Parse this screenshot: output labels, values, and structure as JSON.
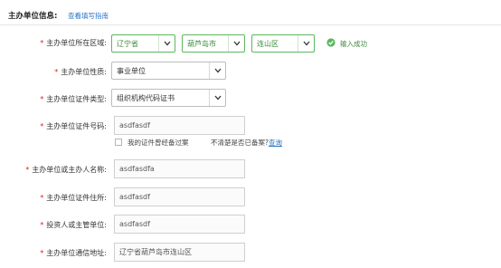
{
  "header": {
    "title": "主办单位信息:",
    "guide_link": "查看填写指南"
  },
  "fields": {
    "region": {
      "label": "主办单位所在区域:",
      "province": "辽宁省",
      "city": "葫芦岛市",
      "district": "连山区",
      "status_text": "输入成功",
      "status_icon": "check-circle-icon"
    },
    "nature": {
      "label": "主办单位性质:",
      "value": "事业单位"
    },
    "cert_type": {
      "label": "主办单位证件类型:",
      "value": "组织机构代码证书"
    },
    "cert_number": {
      "label": "主办单位证件号码:",
      "value": "asdfasdf"
    },
    "cert_filed": {
      "checkbox_label": "我的证件曾经备过案",
      "hint_text": "不清楚是否已备案?",
      "hint_link": "查询"
    },
    "org_name": {
      "label": "主办单位或主办人名称:",
      "value": "asdfasdfa"
    },
    "cert_address": {
      "label": "主办单位证件住所:",
      "value": "asdfasdf"
    },
    "investor": {
      "label": "投资人或主管单位:",
      "value": "asdfasdf"
    },
    "mail_address": {
      "label": "主办单位通信地址:",
      "value": "辽宁省葫芦岛市连山区"
    }
  },
  "colors": {
    "required_marker": "#e02020",
    "success_green": "#5cb85c",
    "link_blue": "#2a73c7"
  }
}
